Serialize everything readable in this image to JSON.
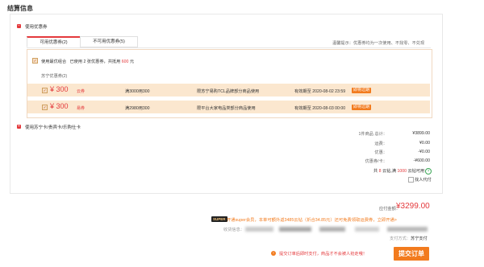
{
  "page": {
    "title": "结算信息"
  },
  "coupon_section": {
    "label": "使用优惠券",
    "tabs": [
      {
        "label": "可用优惠券(2)",
        "active": true
      },
      {
        "label": "不可用优惠券(5)",
        "active": false
      }
    ],
    "hint": "温馨提示：优惠券均为一次使用、不找零、不兑现",
    "best_combo": {
      "prefix": "使用最优组合",
      "middle": "已使用 2 张优惠券，共抵用",
      "amount": "600",
      "suffix": "元"
    },
    "group_label": "苏宁优惠券(2)",
    "coupons": [
      {
        "amount": "¥ 300",
        "tag": "云券",
        "condition": "满3000用300",
        "scope": "限苏宁易购TCL品牌部分商品使用",
        "expiry": "有效期至 2020-08-02 23:59",
        "button": "即将过期"
      },
      {
        "amount": "¥ 300",
        "tag": "易券",
        "condition": "满2980用300",
        "scope": "限平台大家电品类部分商品使用",
        "expiry": "有效期至 2020-08-03 00:00",
        "button": "即将过期"
      }
    ]
  },
  "card_section": {
    "label": "使用苏宁卡/贵宾卡/乐购仕卡"
  },
  "summary": {
    "rows": [
      {
        "label": "1件商品 总计：",
        "value": "¥3899.00"
      },
      {
        "label": "运费：",
        "value": "¥0.00"
      },
      {
        "label": "优惠：",
        "value": "-¥0.00"
      },
      {
        "label": "优惠券/卡：",
        "value": "-¥600.00"
      }
    ],
    "points": {
      "prefix": "共",
      "count": "8",
      "middle": "云钻,满",
      "threshold": "1000",
      "suffix": "云钻可用"
    },
    "proxy_pay": "找人代付"
  },
  "payment": {
    "label": "应付金额：",
    "amount": "¥3299.00",
    "super_badge": "SUPER",
    "super_text": "开通super会员，本单可额外返3485云钻（折合34.85元）还可免费领取运费券，立即开通>",
    "address_label": "收货信息：",
    "method_label": "支付方式：",
    "method_value": "苏宁支付",
    "warning": "提交订单后即时支付，商品才不会被人抢走哦！",
    "submit": "提交订单"
  },
  "colors": {
    "accent": "#e4393c",
    "orange": "#f27b1e",
    "coupon_bg": "#fbe7cf"
  }
}
